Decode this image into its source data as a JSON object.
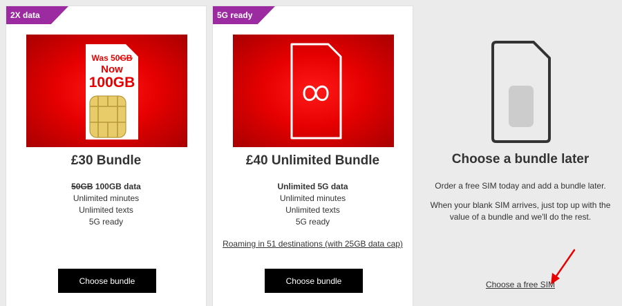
{
  "bundles": [
    {
      "badge": "2X data",
      "hero": {
        "was": "Was 50GB",
        "now": "Now",
        "amount": "100GB"
      },
      "title": "£30 Bundle",
      "data_old": "50GB",
      "data_new": "100GB data",
      "minutes": "Unlimited minutes",
      "texts": "Unlimited texts",
      "network": "5G ready",
      "button": "Choose bundle"
    },
    {
      "badge": "5G ready",
      "title": "£40 Unlimited Bundle",
      "data": "Unlimited 5G data",
      "minutes": "Unlimited minutes",
      "texts": "Unlimited texts",
      "network": "5G ready",
      "roaming_link": "Roaming in 51 destinations (with 25GB data cap)",
      "button": "Choose bundle"
    }
  ],
  "later": {
    "title": "Choose a bundle later",
    "text1": "Order a free SIM today and add a bundle later.",
    "text2_line1": "When your blank SIM arrives, just top up with the",
    "text2_line2": "value of a bundle and we'll do the rest.",
    "link": "Choose a free SIM"
  },
  "colors": {
    "brand_red": "#e60000",
    "badge_purple": "#9c2aa0",
    "button_black": "#000000",
    "annotation_arrow": "#e60000"
  }
}
